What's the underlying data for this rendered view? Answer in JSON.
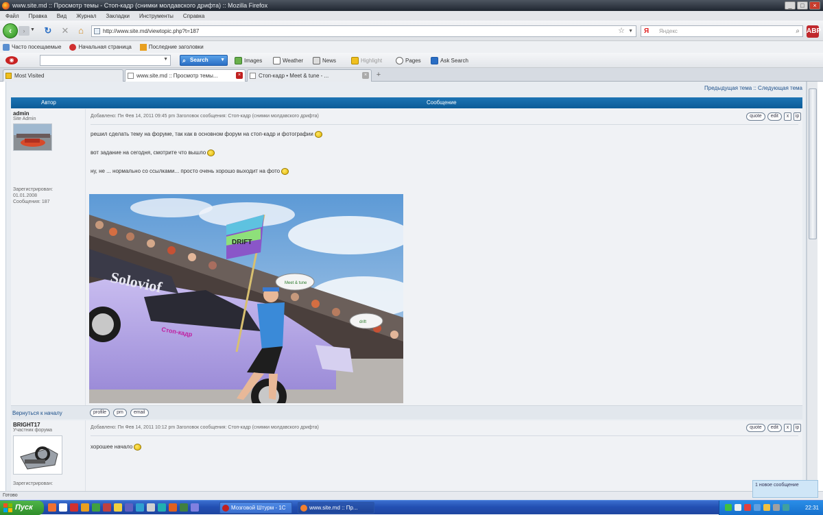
{
  "window": {
    "title": "www.site.md :: Просмотр темы - Стоп-кадр (снимки молдавского дрифта) :: Mozilla Firefox",
    "buttons": [
      "_",
      "□",
      "×"
    ]
  },
  "menu": [
    "Файл",
    "Правка",
    "Вид",
    "Журнал",
    "Закладки",
    "Инструменты",
    "Справка"
  ],
  "nav": {
    "url": "http://www.site.md/viewtopic.php?t=187",
    "search_placeholder": "Яндекс",
    "search_logo": "Я"
  },
  "bookmarks": [
    "Часто посещаемые",
    "Начальная страница",
    "Последние заголовки"
  ],
  "toolbar2": {
    "search_button": "Search",
    "items": [
      "Images",
      "Weather",
      "News",
      "Highlight",
      "Pages",
      "Ask Search"
    ]
  },
  "tabs": [
    {
      "label": "Most Visited",
      "active": false
    },
    {
      "label": "www.site.md :: Просмотр темы...",
      "active": true
    },
    {
      "label": "Стоп-кадр • Meet & tune - ...",
      "active": false
    }
  ],
  "forum": {
    "topic_nav": "Предыдущая тема :: Следующая тема",
    "col_author": "Автор",
    "col_message": "Сообщение",
    "posts": [
      {
        "author": "admin",
        "rank": "Site Admin",
        "info": [
          "Зарегистрирован:",
          "01.01.2008",
          "Сообщения: 187"
        ],
        "meta": "Добавлено: Пн Фев 14, 2011 09:45 pm    Заголовок сообщения: Стоп-кадр (снимки молдавского дрифта)",
        "lines": [
          "решил сделать тему на форуме, так как в основном форум на стоп-кадр и фотографии",
          "вот задание на сегодня, смотрите что вышло",
          "ну, не ... нормально со ссылками... просто очень хорошо выходит на фото"
        ],
        "photo_flag_text": "DRIFT",
        "photo_car_text": "Soloviof",
        "photo_door_text": "Стоп-кадр",
        "photo_bubble1": "Meet & tune",
        "photo_bubble2": "drift"
      },
      {
        "author": "BRIGHT17",
        "rank": "Участник форума",
        "info": [
          "Зарегистрирован:"
        ],
        "meta": "Добавлено: Пн Фев 14, 2011 10:12 pm    Заголовок сообщения: Стоп-кадр (снимки молдавского дрифта)",
        "lines": [
          "хорошее начало"
        ]
      }
    ],
    "post_buttons": [
      "quote",
      "edit",
      "x",
      "ip"
    ],
    "back_to_top": "Вернуться к началу",
    "footer_buttons": [
      "profile",
      "pm",
      "email"
    ]
  },
  "status": "Готово",
  "popup_text": "1 новое сообщение",
  "taskbar": {
    "start": "Пуск",
    "windows": [
      "Мозговой Штурм - 1С",
      "www.site.md :: Пр..."
    ],
    "clock": "22:31"
  },
  "colors": {
    "header_blue": "#0d5c98",
    "link_blue": "#1b4f8a",
    "taskbar_blue": "#2350b3",
    "start_green": "#3a9a33"
  }
}
